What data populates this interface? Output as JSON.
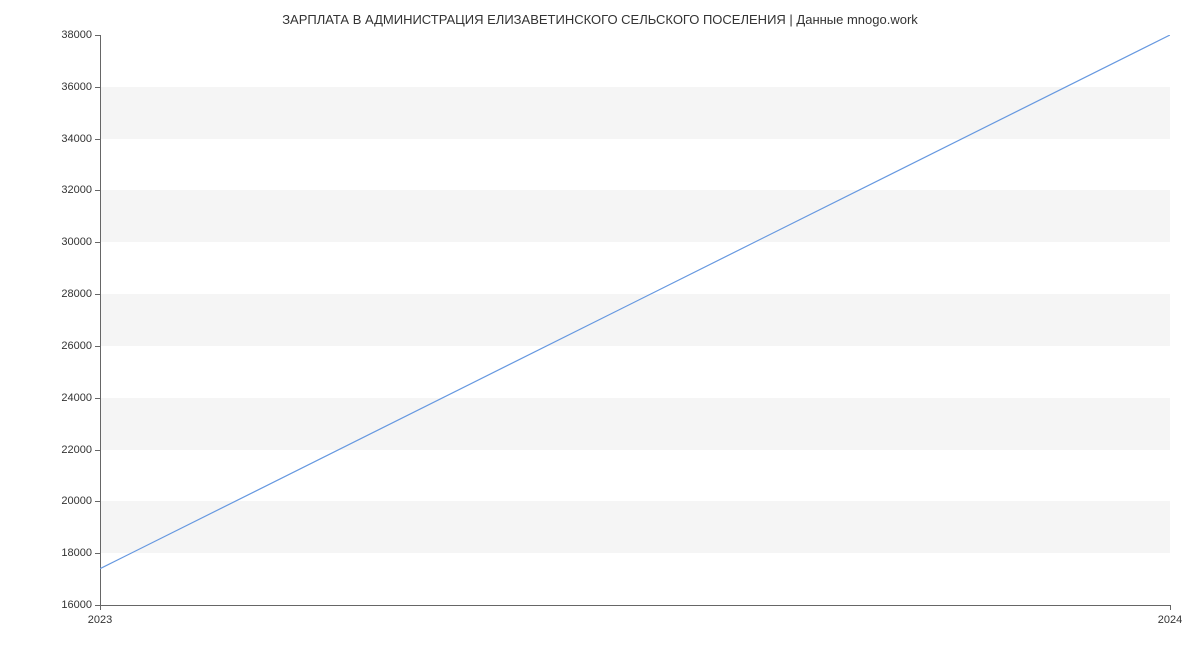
{
  "chart_data": {
    "type": "line",
    "title": "ЗАРПЛАТА В АДМИНИСТРАЦИЯ ЕЛИЗАВЕТИНСКОГО СЕЛЬСКОГО ПОСЕЛЕНИЯ | Данные mnogo.work",
    "x": [
      2023,
      2024
    ],
    "values": [
      17400,
      38000
    ],
    "xlabel": "",
    "ylabel": "",
    "xlim": [
      2023,
      2024
    ],
    "ylim": [
      16000,
      38000
    ],
    "x_ticks": [
      2023,
      2024
    ],
    "y_ticks": [
      16000,
      18000,
      20000,
      22000,
      24000,
      26000,
      28000,
      30000,
      32000,
      34000,
      36000,
      38000
    ],
    "line_color": "#6698e0",
    "grid_band_color": "#f5f5f5"
  }
}
